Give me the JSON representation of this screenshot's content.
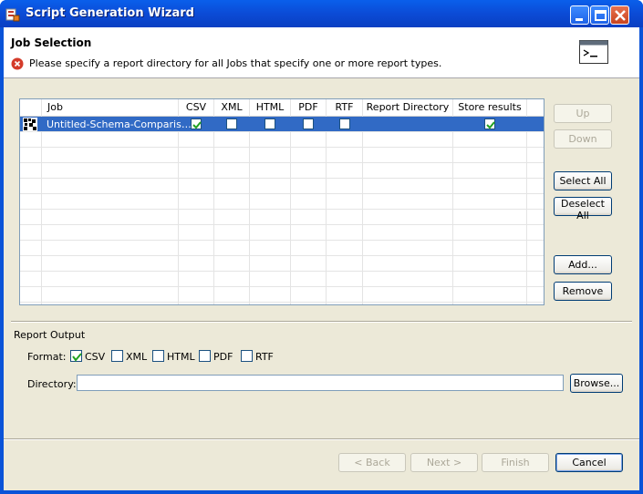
{
  "window": {
    "title": "Script Generation Wizard"
  },
  "header": {
    "title": "Job Selection",
    "message": "Please specify a report directory for all Jobs that specify one or more report types."
  },
  "table": {
    "columns": [
      "Job",
      "CSV",
      "XML",
      "HTML",
      "PDF",
      "RTF",
      "Report Directory",
      "Store results"
    ],
    "rows": [
      {
        "job": "Untitled-Schema-Comparis…",
        "csv": true,
        "xml": false,
        "html": false,
        "pdf": false,
        "rtf": false,
        "report_directory": "",
        "store_results": true,
        "selected": true
      }
    ]
  },
  "side_buttons": {
    "up": "Up",
    "down": "Down",
    "select_all": "Select All",
    "deselect_all": "Deselect All",
    "add": "Add...",
    "remove": "Remove"
  },
  "report_output": {
    "group_label": "Report Output",
    "format_label": "Format:",
    "formats": [
      {
        "label": "CSV",
        "checked": true
      },
      {
        "label": "XML",
        "checked": false
      },
      {
        "label": "HTML",
        "checked": false
      },
      {
        "label": "PDF",
        "checked": false
      },
      {
        "label": "RTF",
        "checked": false
      }
    ],
    "directory_label": "Directory:",
    "directory_value": "",
    "browse": "Browse..."
  },
  "footer": {
    "back": "< Back",
    "next": "Next >",
    "finish": "Finish",
    "cancel": "Cancel"
  },
  "colors": {
    "selection": "#316AC5",
    "titlebar": "#0A53D8",
    "dialog_bg": "#ECE9D8"
  }
}
